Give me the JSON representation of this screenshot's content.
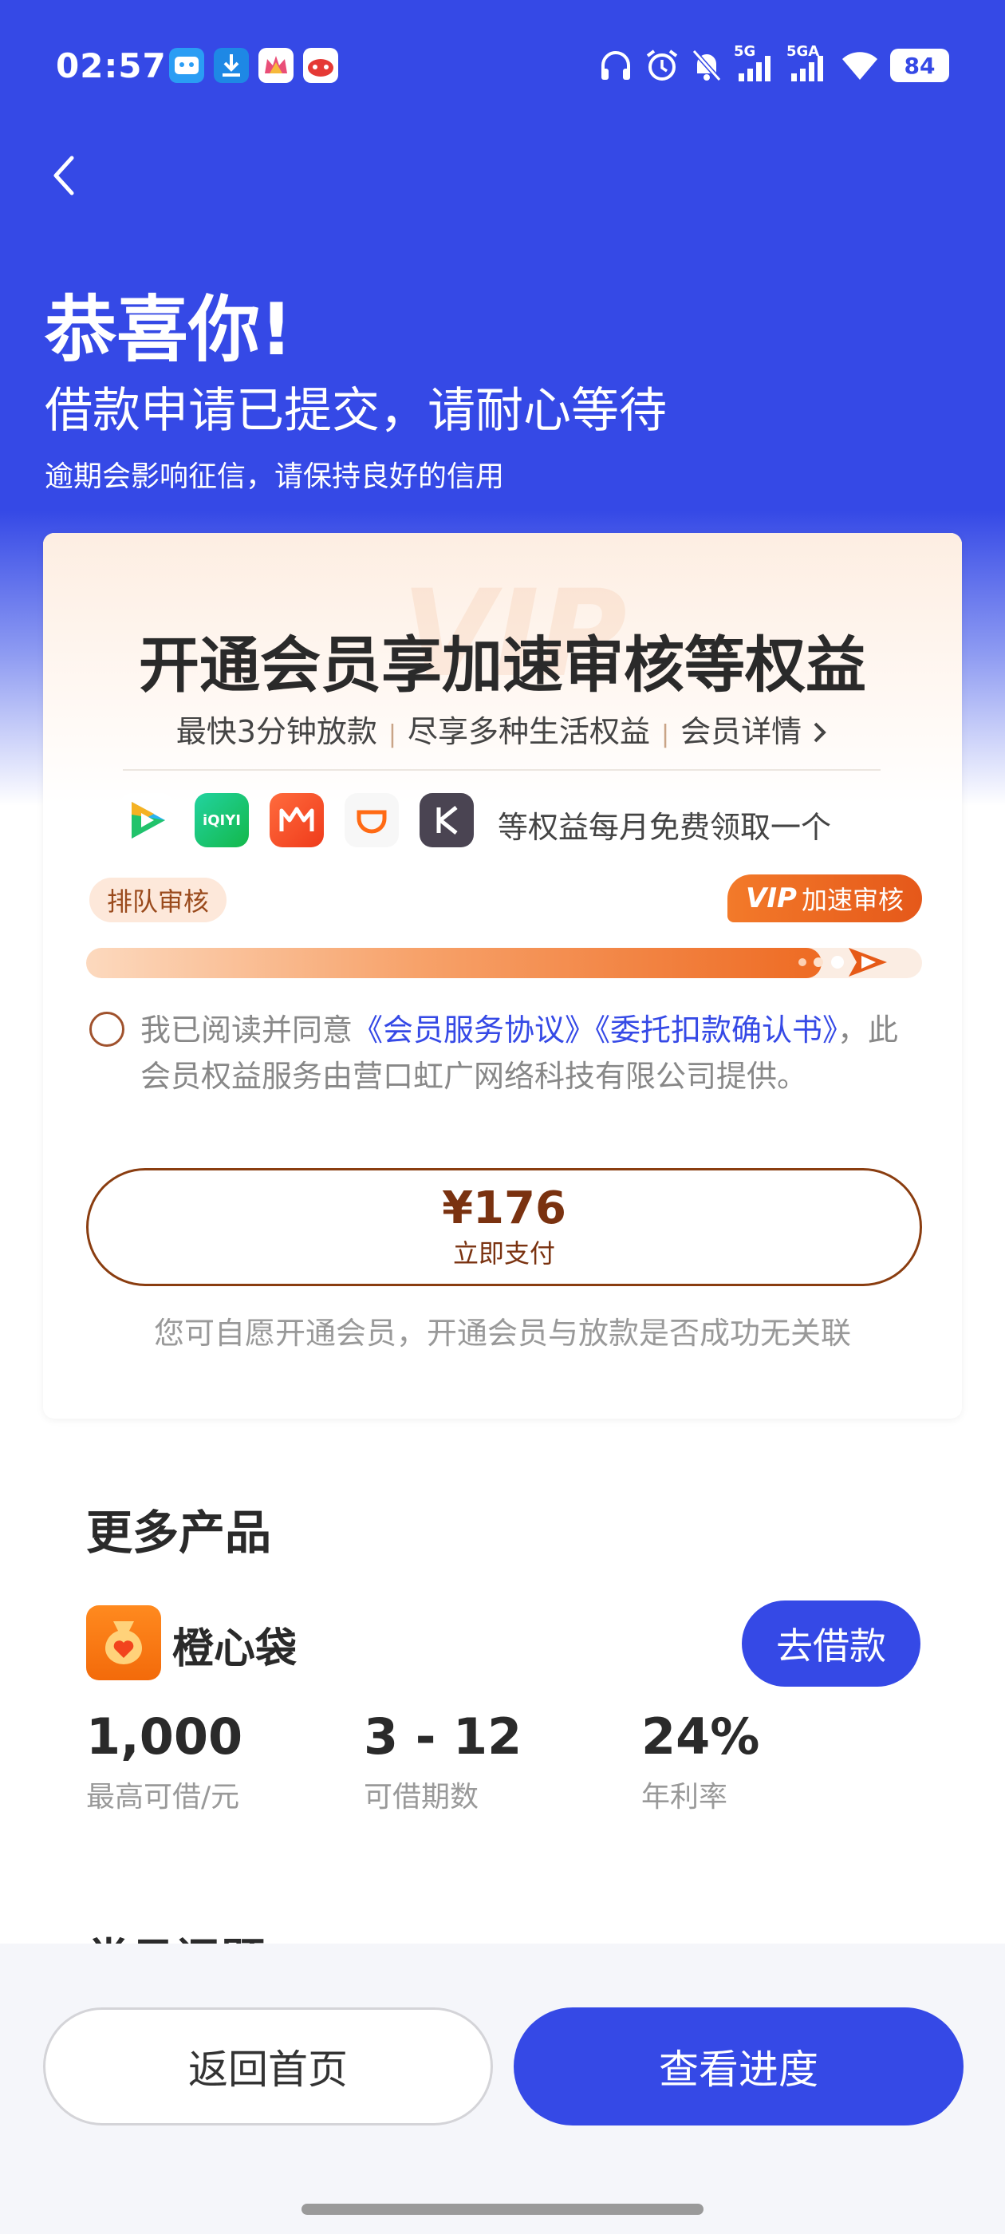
{
  "status_bar": {
    "time": "02:57",
    "battery": "84",
    "network_1": "5G",
    "network_2": "5GA",
    "notification_icons": [
      "app-icon-1",
      "download-icon",
      "crown-app-icon",
      "game-app-icon"
    ],
    "system_icons": [
      "headphones-icon",
      "alarm-icon",
      "mute-icon",
      "signal-icon",
      "signal-icon",
      "wifi-icon",
      "battery-icon"
    ]
  },
  "header": {
    "title": "恭喜你!",
    "subtitle": "借款申请已提交，请耐心等待",
    "note": "逾期会影响征信，请保持良好的信用"
  },
  "vip_card": {
    "watermark": "VIP",
    "title": "开通会员享加速审核等权益",
    "links": [
      "最快3分钟放款",
      "尽享多种生活权益",
      "会员详情"
    ],
    "perk_apps": [
      {
        "name": "tencent-video-icon",
        "color": "#1EC17A",
        "glyph": "▶"
      },
      {
        "name": "iqiyi-icon",
        "color": "#16C25B",
        "glyph": "iQIYI"
      },
      {
        "name": "mango-tv-icon",
        "color": "#F2571E",
        "glyph": "M"
      },
      {
        "name": "didi-icon",
        "color": "#FFFFFF",
        "glyph": "D"
      },
      {
        "name": "keep-icon",
        "color": "#4A4452",
        "glyph": "K"
      }
    ],
    "perk_text": "等权益每月免费领取一个",
    "queue_label": "排队审核",
    "vip_label_prefix": "VIP",
    "vip_label": "加速审核",
    "progress_fraction": 0.88,
    "agreement": {
      "prefix": "我已阅读并同意",
      "link1": "《会员服务协议》",
      "link2": "《委托扣款确认书》",
      "suffix": "，此会员权益服务由营口虹广网络科技有限公司提供。"
    },
    "pay_price": "¥176",
    "pay_label": "立即支付",
    "voluntary_note": "您可自愿开通会员，开通会员与放款是否成功无关联"
  },
  "more_products": {
    "title": "更多产品",
    "product": {
      "name": "橙心袋",
      "button": "去借款",
      "stats": [
        {
          "value": "1,000",
          "label": "最高可借/元"
        },
        {
          "value": "3 - 12",
          "label": "可借期数"
        },
        {
          "value": "24%",
          "label": "年利率"
        }
      ]
    }
  },
  "faq_peek": "常见问题",
  "bottom_bar": {
    "home_button": "返回首页",
    "progress_button": "查看进度"
  },
  "colors": {
    "primary": "#3549E6",
    "vip_orange": "#EE6B23",
    "pay_brown": "#7A3210"
  }
}
